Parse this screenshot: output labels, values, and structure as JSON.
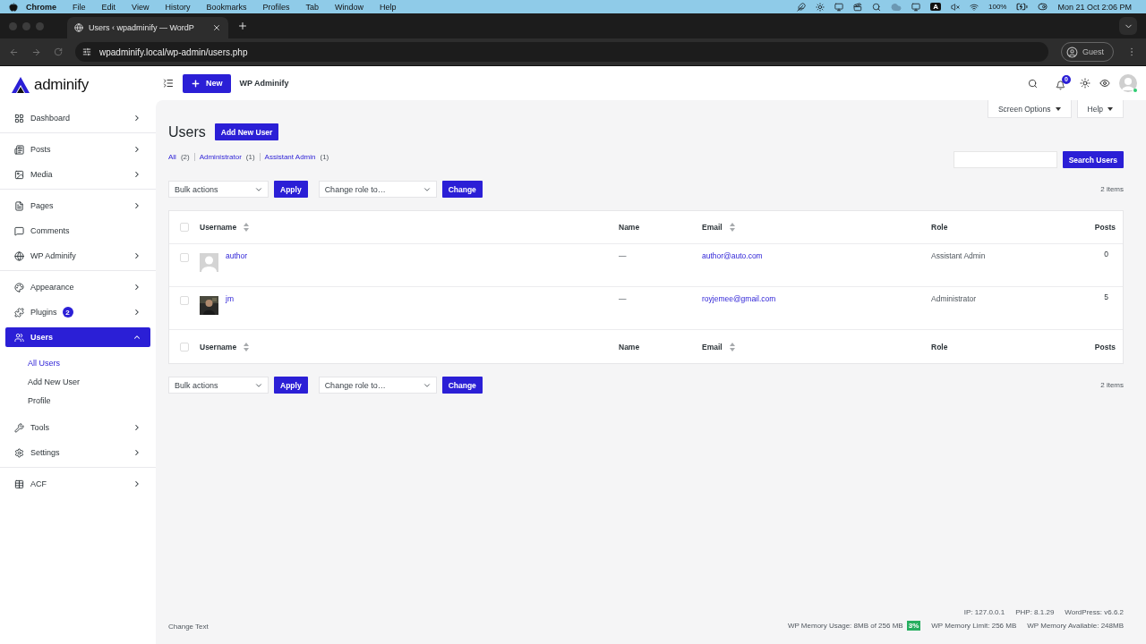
{
  "menubar": {
    "app": "Chrome",
    "items": [
      "File",
      "Edit",
      "View",
      "History",
      "Bookmarks",
      "Profiles",
      "Tab",
      "Window",
      "Help"
    ],
    "input_source": "A",
    "battery": "100%",
    "clock": "Mon 21 Oct  2:06 PM"
  },
  "browser": {
    "tab": {
      "title": "Users ‹ wpadminify — WordP",
      "selected": true
    },
    "url": "wpadminify.local/wp-admin/users.php",
    "profile": "Guest"
  },
  "topbar": {
    "logo": "adminify",
    "new_button": "New",
    "site_name": "WP Adminify",
    "notifications": "0"
  },
  "sidebar": {
    "groups": [
      {
        "items": [
          {
            "label": "Dashboard",
            "has_submenu": true,
            "expanded": false,
            "selected": false
          }
        ]
      },
      {
        "items": [
          {
            "label": "Posts",
            "has_submenu": true,
            "expanded": false,
            "selected": false
          },
          {
            "label": "Media",
            "has_submenu": true,
            "expanded": false,
            "selected": false
          }
        ]
      },
      {
        "items": [
          {
            "label": "Pages",
            "has_submenu": true,
            "expanded": false,
            "selected": false
          },
          {
            "label": "Comments",
            "has_submenu": false,
            "expanded": false,
            "selected": false
          },
          {
            "label": "WP Adminify",
            "has_submenu": true,
            "expanded": false,
            "selected": false
          }
        ]
      },
      {
        "items": [
          {
            "label": "Appearance",
            "has_submenu": true,
            "expanded": false,
            "selected": false
          },
          {
            "label": "Plugins",
            "badge": "2",
            "has_submenu": true,
            "expanded": false,
            "selected": false
          },
          {
            "label": "Users",
            "has_submenu": true,
            "expanded": true,
            "selected": true,
            "children": [
              {
                "label": "All Users",
                "selected": true
              },
              {
                "label": "Add New User",
                "selected": false
              },
              {
                "label": "Profile",
                "selected": false
              }
            ]
          },
          {
            "label": "Tools",
            "has_submenu": true,
            "expanded": false,
            "selected": false
          },
          {
            "label": "Settings",
            "has_submenu": true,
            "expanded": false,
            "selected": false
          }
        ]
      },
      {
        "items": [
          {
            "label": "ACF",
            "has_submenu": true,
            "expanded": false,
            "selected": false
          }
        ]
      }
    ]
  },
  "screen_tabs": [
    "Screen Options",
    "Help"
  ],
  "page": {
    "title": "Users",
    "add_button": "Add New User",
    "filters": [
      {
        "label": "All",
        "count": "(2)"
      },
      {
        "label": "Administrator",
        "count": "(1)"
      },
      {
        "label": "Assistant Admin",
        "count": "(1)"
      }
    ],
    "search_button": "Search Users",
    "toolbars": [
      {
        "bulk": "Bulk actions",
        "apply": "Apply",
        "role": "Change role to…",
        "change": "Change",
        "count": "2 items"
      },
      {
        "bulk": "Bulk actions",
        "apply": "Apply",
        "role": "Change role to…",
        "change": "Change",
        "count": "2 items"
      }
    ]
  },
  "table": {
    "header_checked": false,
    "footer_checked": false,
    "columns": [
      {
        "label": "Username",
        "sortable": true
      },
      {
        "label": "Name",
        "sortable": false
      },
      {
        "label": "Email",
        "sortable": true
      },
      {
        "label": "Role",
        "sortable": false
      },
      {
        "label": "Posts",
        "sortable": false
      }
    ],
    "footer_columns": [
      {
        "label": "Username",
        "sortable": true
      },
      {
        "label": "Name",
        "sortable": false
      },
      {
        "label": "Email",
        "sortable": true
      },
      {
        "label": "Role",
        "sortable": false
      },
      {
        "label": "Posts",
        "sortable": false
      }
    ],
    "rows": [
      {
        "username": "author",
        "avatar": {
          "kind": "placeholder"
        },
        "name": "—",
        "email": "author@auto.com",
        "role": "Assistant Admin",
        "posts": "0",
        "checked": false
      },
      {
        "username": "jm",
        "name": "—",
        "email": "royjemee@gmail.com",
        "role": "Administrator",
        "posts": "5",
        "checked": false
      }
    ]
  },
  "footer": {
    "left": "Change Text",
    "info": [
      "IP: 127.0.0.1",
      "PHP: 8.1.29",
      "WordPress: v6.6.2"
    ],
    "memory_usage": "WP Memory Usage: 8MB of 256 MB",
    "memory_percent": "3%",
    "memory": [
      "WP Memory Limit: 256 MB",
      "WP Memory Available: 248MB"
    ]
  }
}
